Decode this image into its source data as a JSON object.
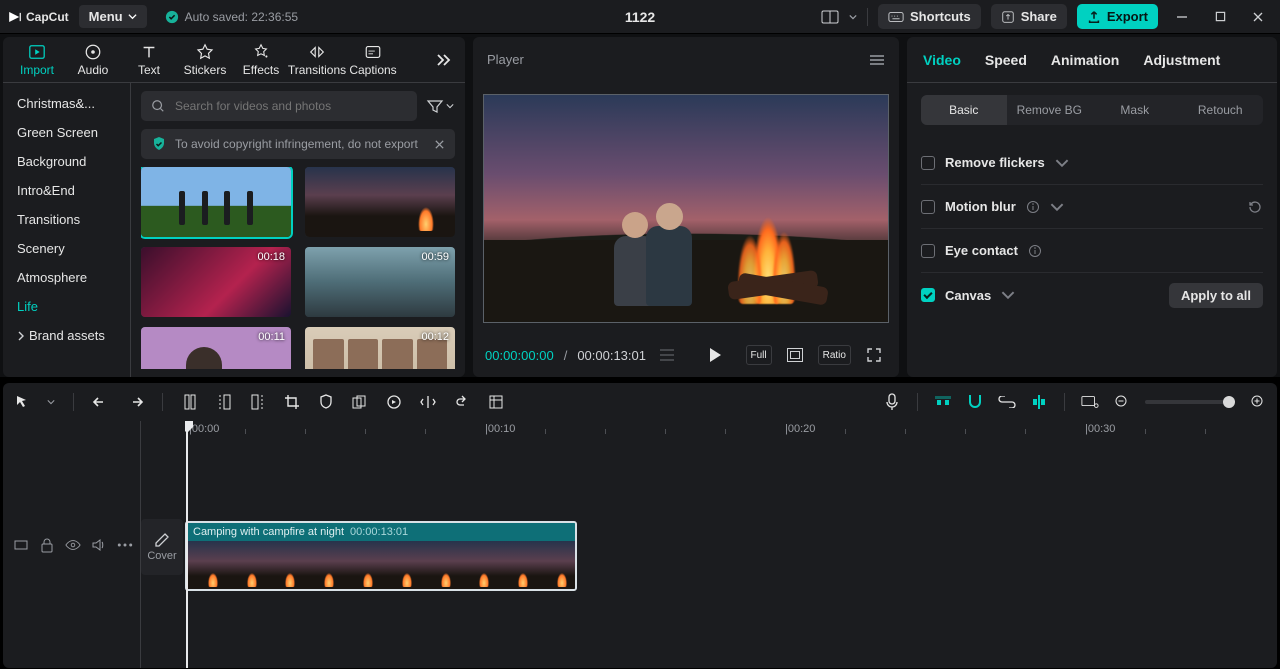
{
  "app": {
    "name": "CapCut",
    "menu": "Menu",
    "autosaved": "Auto saved: 22:36:55",
    "project": "1122"
  },
  "titlebar": {
    "shortcuts": "Shortcuts",
    "share": "Share",
    "export": "Export"
  },
  "mediaTabs": [
    "Import",
    "Audio",
    "Text",
    "Stickers",
    "Effects",
    "Transitions",
    "Captions"
  ],
  "mediaActive": 0,
  "categories": [
    "Christmas&...",
    "Green Screen",
    "Background",
    "Intro&End",
    "Transitions",
    "Scenery",
    "Atmosphere",
    "Life"
  ],
  "categoriesActive": 7,
  "brandAssets": "Brand assets",
  "search": {
    "placeholder": "Search for videos and photos"
  },
  "warn": "To avoid copyright infringement, do not export",
  "thumbs": [
    {
      "dur": ""
    },
    {
      "dur": ""
    },
    {
      "dur": "00:18"
    },
    {
      "dur": "00:59"
    },
    {
      "dur": "00:11"
    },
    {
      "dur": "00:12"
    }
  ],
  "player": {
    "title": "Player",
    "tc": "00:00:00:00",
    "total": "00:00:13:01",
    "full": "Full",
    "ratio": "Ratio"
  },
  "inspector": {
    "tabs": [
      "Video",
      "Speed",
      "Animation",
      "Adjustment"
    ],
    "active": 0,
    "subtabs": [
      "Basic",
      "Remove BG",
      "Mask",
      "Retouch"
    ],
    "subActive": 0,
    "rows": {
      "flickers": "Remove flickers",
      "motion": "Motion blur",
      "eye": "Eye contact",
      "canvas": "Canvas"
    },
    "apply": "Apply to all"
  },
  "timeline": {
    "ruler": [
      "00:00",
      "00:10",
      "00:20",
      "00:30"
    ],
    "clip": {
      "title": "Camping with campfire at night",
      "dur": "00:00:13:01"
    },
    "cover": "Cover"
  }
}
